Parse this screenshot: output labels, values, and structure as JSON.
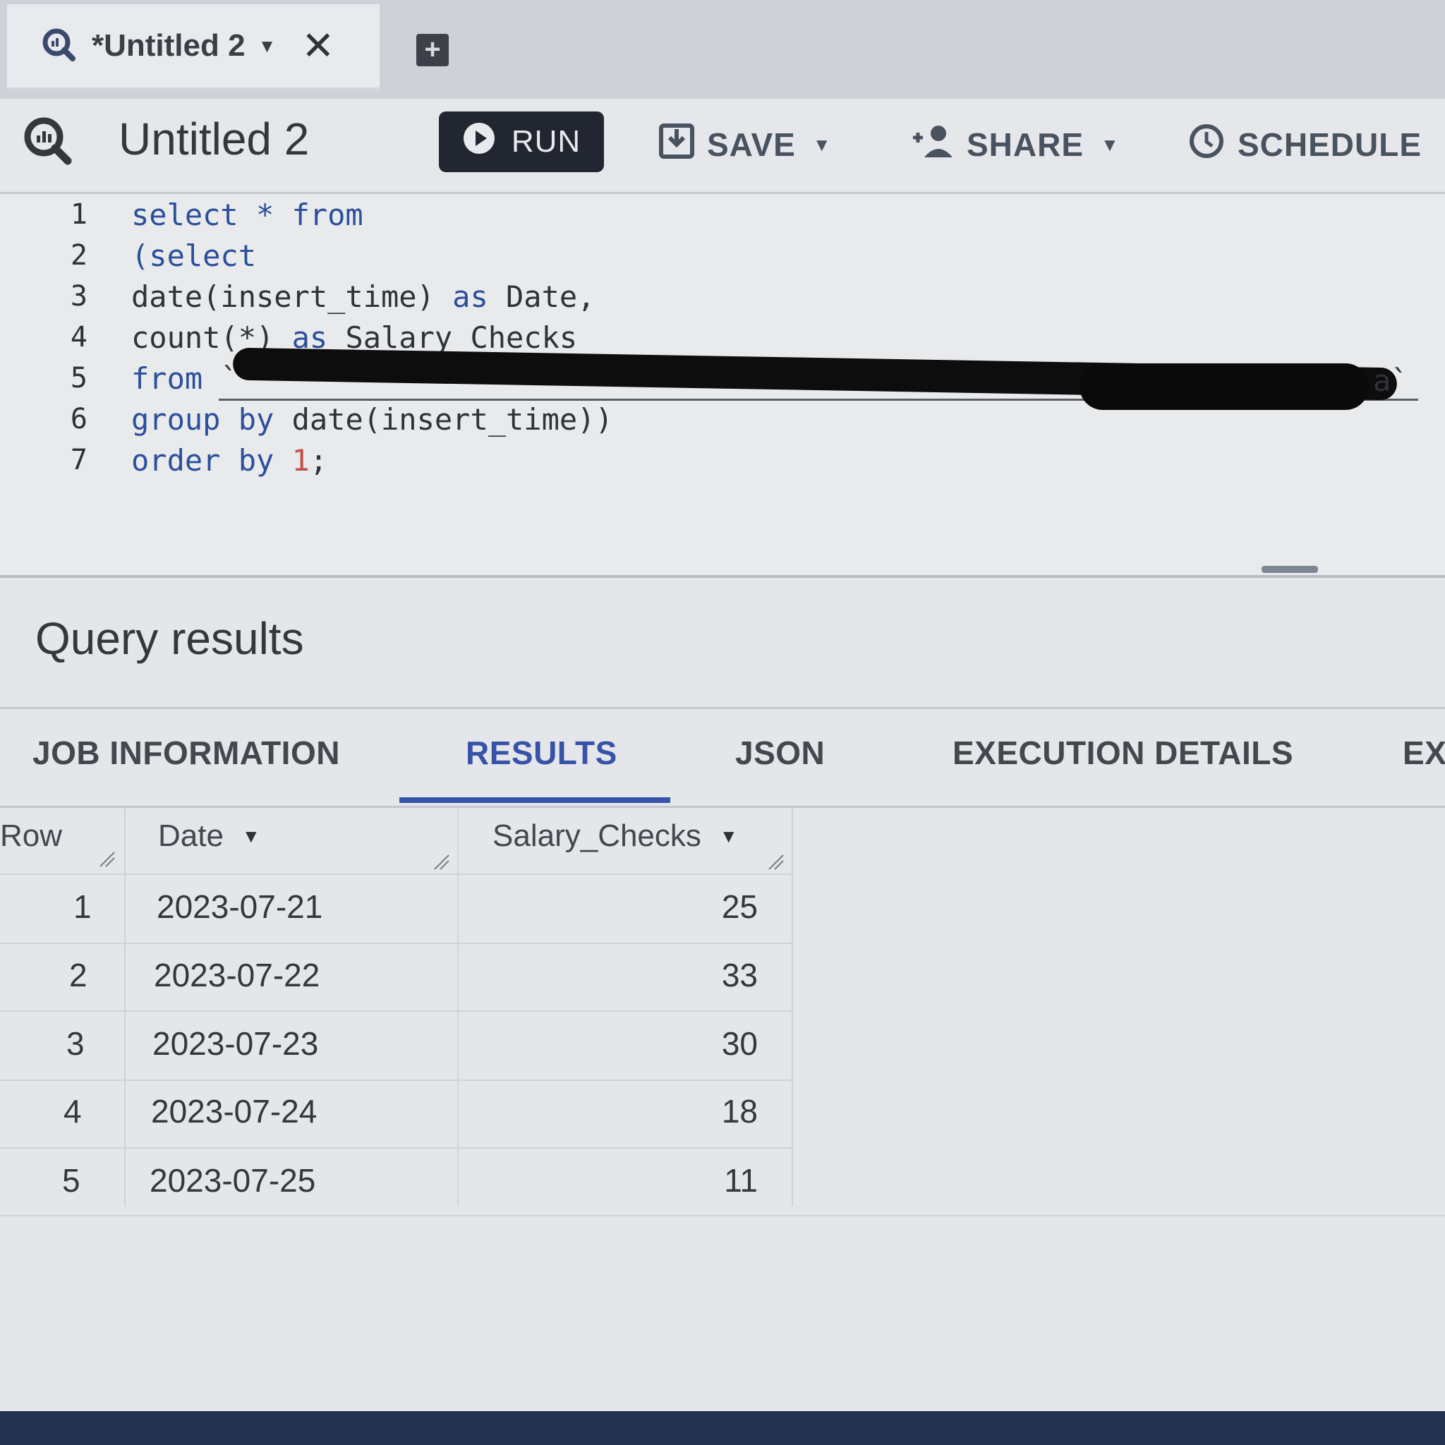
{
  "browser_tab": {
    "title": "*Untitled 2",
    "caret": "▼",
    "close": "✕",
    "new_tab": "+"
  },
  "toolbar": {
    "title": "Untitled 2",
    "run_label": "RUN",
    "save_label": "SAVE",
    "share_label": "SHARE",
    "schedule_label": "SCHEDULE",
    "caret": "▼"
  },
  "editor": {
    "lines": [
      {
        "n": "1",
        "parts": [
          {
            "t": "select * from",
            "c": "kw"
          }
        ]
      },
      {
        "n": "2",
        "parts": [
          {
            "t": "(select",
            "c": "kw"
          }
        ]
      },
      {
        "n": "3",
        "parts": [
          {
            "t": "date(insert_time) ",
            "c": ""
          },
          {
            "t": "as",
            "c": "kw"
          },
          {
            "t": " Date,",
            "c": ""
          }
        ]
      },
      {
        "n": "4",
        "parts": [
          {
            "t": "count(*) ",
            "c": ""
          },
          {
            "t": "as",
            "c": "kw"
          },
          {
            "t": " Salary_Checks",
            "c": ""
          }
        ]
      },
      {
        "n": "5",
        "parts": [
          {
            "t": "from",
            "c": "kw"
          },
          {
            "t": " `",
            "c": ""
          }
        ]
      },
      {
        "n": "6",
        "parts": [
          {
            "t": "group by",
            "c": "kw"
          },
          {
            "t": " date(insert_time))",
            "c": ""
          }
        ]
      },
      {
        "n": "7",
        "parts": [
          {
            "t": "order by",
            "c": "kw"
          },
          {
            "t": " ",
            "c": ""
          },
          {
            "t": "1",
            "c": "num"
          },
          {
            "t": ";",
            "c": ""
          }
        ]
      }
    ],
    "line5_tail": "a`"
  },
  "results": {
    "title": "Query results",
    "tabs": [
      "JOB INFORMATION",
      "RESULTS",
      "JSON",
      "EXECUTION DETAILS",
      "EX"
    ],
    "active_tab": "RESULTS",
    "columns": {
      "row": "Row",
      "date": "Date",
      "salary_checks": "Salary_Checks"
    },
    "rows": [
      {
        "row": "1",
        "date": "2023-07-21",
        "salary_checks": "25"
      },
      {
        "row": "2",
        "date": "2023-07-22",
        "salary_checks": "33"
      },
      {
        "row": "3",
        "date": "2023-07-23",
        "salary_checks": "30"
      },
      {
        "row": "4",
        "date": "2023-07-24",
        "salary_checks": "18"
      },
      {
        "row": "5",
        "date": "2023-07-25",
        "salary_checks": "11"
      }
    ]
  },
  "colors": {
    "accent": "#3753a8",
    "run_bg": "#222630",
    "keyword": "#2b4f9c",
    "number": "#c2504a"
  },
  "icons": [
    "bigquery-logo-icon",
    "close-icon",
    "add-tab-icon",
    "play-icon",
    "save-icon",
    "share-person-icon",
    "clock-icon",
    "sort-caret-icon",
    "resize-grip-icon"
  ]
}
